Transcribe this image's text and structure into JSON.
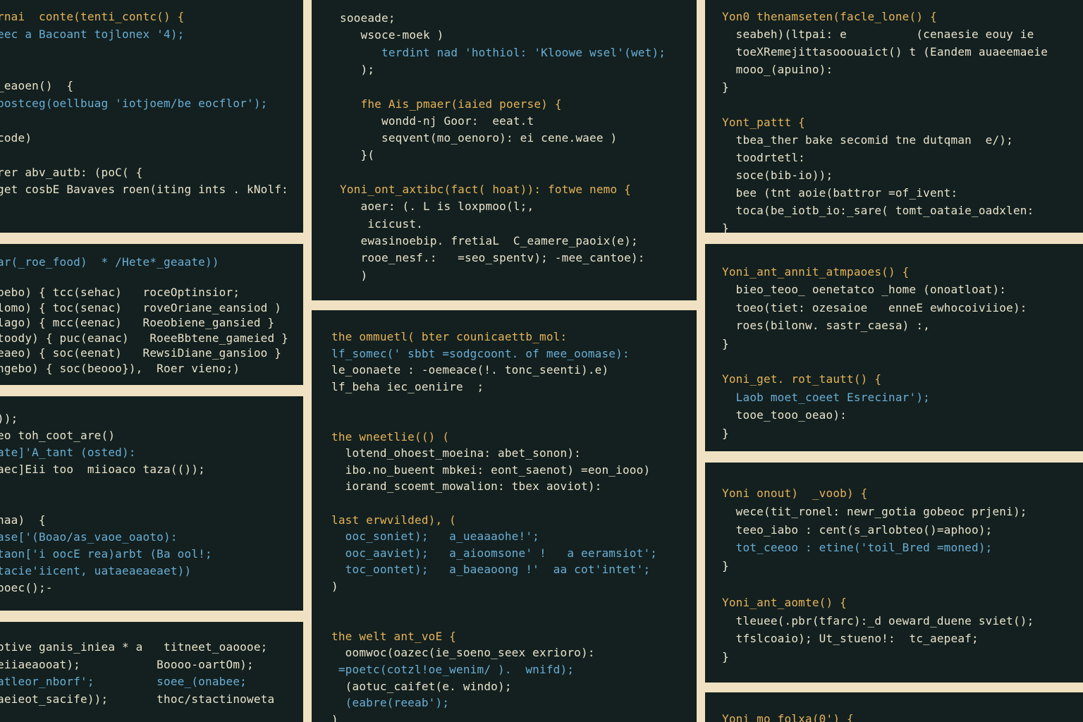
{
  "palette": {
    "background": "#efe1c2",
    "panel": "#13201f",
    "keyword": "#e6b35a",
    "text": "#eae3cc",
    "string": "#6aaed6"
  },
  "panels": [
    {
      "name": "left-top",
      "lines": [
        "rnai  conte(tenti_contc() {",
        "eec a Bacoant tojlonex '4);",
        "",
        "",
        "_eaoen()  {",
        "bostceg(oellbuag 'iotjoem/be eocflor');",
        "",
        "code)",
        "",
        "rer abv_autb: (poC( {",
        "get cosbE Bavaves roen(iting ints . kNolf:"
      ]
    },
    {
      "name": "left-second",
      "lines": [
        "ar(_roe_food)  * /Hete*_geaate))",
        "",
        "bebo) { tcc(sehac)   roceOptinsior;",
        "lomo) { toc(senac)   roveOriane_eansiod )",
        "lago) { mcc(eenac)   Roeobiene_gansied }",
        "toody) { puc(eanac)   RoeeBbtene_gameied }",
        "eaeo) { soc(eenat)   RewsiDiane_gansioo }",
        "ngebo) { soc(beooo}),  Roer vieno;)"
      ]
    },
    {
      "name": "left-third",
      "lines": [
        "));",
        "eo toh_coot_are()",
        "ate]'A_tant (osted):",
        "aec]Eii too  miioaco taza(());",
        "",
        "",
        "naa)  {",
        "ase['(Boao/as_vaoe_oaoto):",
        "taon['i oocE rea)arbt (Ba ool!;",
        "tacie'iicent, uataeaeaeaet))",
        "poec();-"
      ]
    },
    {
      "name": "left-bottom",
      "lines": [
        "otive ganis_iniea * a   titneet_oaoooe;",
        "eiiaeaooat);           Boooo-oartOm);",
        "atleor_nborf';         soee_(onabee;",
        "aeieot_sacife));       thoc/stactinoweta"
      ]
    },
    {
      "name": "center-top",
      "lines": [
        "sooeade;",
        "   wsoce-moek )",
        "      terdint nad 'hothiol: 'Kloowe wsel'(wet);",
        "   );",
        "",
        "   fhe Ais_pmaer(iaied poerse) {",
        "      wondd-nj Goor:  eeat.t",
        "      seqvent(mo_oenoro): ei cene.waee )",
        "   }(",
        "",
        "Yoni_ont_axtibc(fact( hoat)): fotwe nemo {",
        "   aoer: (. L is loxpmoo(l;,",
        "    icicust.",
        "   ewasinoebip. fretiaL  C_eamere_paoix(e);",
        "   rooe_nesf.:   =seo_spentv); -mee_cantoe):",
        "   )"
      ]
    },
    {
      "name": "center-bottom",
      "lines": [
        "the ommuetl( bter counicaettb_mol:",
        "lf_somec(' sbbt =sodgcoont. of mee_oomase):",
        "le_oonaete : -oemeace(!. tonc_seenti).e)",
        "lf_beha iec_oeniire  ;",
        "",
        "",
        "the wneetlie(() (",
        "  lotend_ohoest_moeina: abet_sonon):",
        "  ibo.no_bueent mbkei: eont_saenot) =eon_iooo)",
        "  iorand_scoemt_mowalion: tbex aoviot):",
        "",
        "last erwvilded), (",
        "  ooc_soniet);   a_ueaaaohe!';",
        "  ooc_aaviet);   a_aioomsone' !   a eeramsiot';",
        "  toc_oontet);   a_baeaoong !'  aa cot'intet';",
        ")",
        "",
        "",
        "the welt ant_voE {",
        "  oomwoc(oazec(ie_soeno_seex exrioro):",
        " =poetc(cotzl!oe_wenim/ ).  wnifd);",
        "  (aotuc_caifet(e. windo);",
        "  (eabre(reeab');",
        ")"
      ]
    },
    {
      "name": "right-top",
      "lines": [
        "Yon0 thenamseten(facle_lone() {",
        "  seabeh)(ltpai: e          (cenaesie eouy ie",
        "  toeXRemejittasooouaict() t (Eandem auaeemaeie",
        "  mooo_(apuino):",
        "}",
        "",
        "Yont_pattt {",
        "  tbea_ther bake secomid tne dutqman  e/);",
        "  toodrtetl:",
        "  soce(bib-io));",
        "  bee (tnt aoie(battror =of_ivent:",
        "  toca(be_iotb_io:_sare( tomt_oataie_oadxlen:",
        "}"
      ]
    },
    {
      "name": "right-second",
      "lines": [
        "Yoni_ant_annit_atmpaoes() {",
        "  bieo_teoo_ oenetatco _home (onoatloat):",
        "  toeo(tiet: ozesaioe   enneE ewhocoiviioe):",
        "  roes(bilonw. sastr_caesa) :,",
        "}",
        "",
        "Yoni_get. rot_tautt() {",
        "  Laob moet_coeet Esrecinar');",
        "  tooe_tooo_oeao):",
        "}"
      ]
    },
    {
      "name": "right-third",
      "lines": [
        "Yoni onout)  _voob) {",
        "  wece(tit_ronel: newr_gotia gobeoc prjeni);",
        "  teeo_iabo : cent(s_arlobteo()=aphoo);",
        "  tot_ceeoo : etine('toil_Bred =moned);",
        "}",
        "",
        "Yoni_ant_aomte() {",
        "  tleuee(.pbr(tfarc):_d oeward_duene sviet();",
        "  tfslcoaio); Ut_stueno!:  tc_aepeaf;",
        "}"
      ]
    },
    {
      "name": "right-bottom",
      "lines": [
        "Yoni_mo_folxa(0') {"
      ]
    }
  ]
}
